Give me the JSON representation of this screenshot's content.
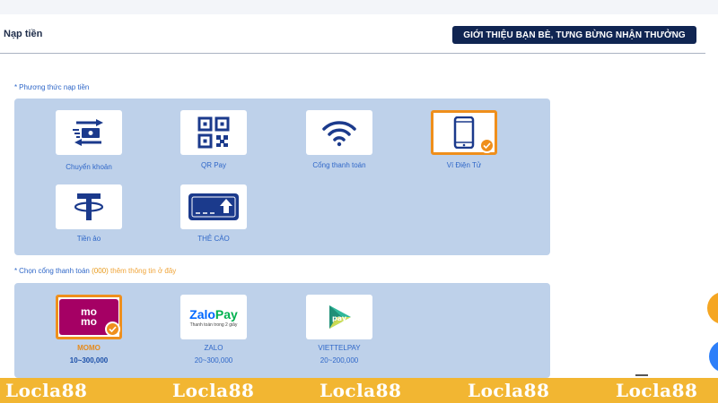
{
  "header": {
    "title": "Nạp tiền",
    "promo_button": "GIỚI THIỆU BẠN BÈ, TƯNG BỪNG NHẬN THƯỞNG"
  },
  "methods_section": {
    "required_mark": "*",
    "label": "Phương thức nạp tiền",
    "items": [
      {
        "label": "Chuyển khoản",
        "icon": "bank-transfer-icon",
        "selected": false
      },
      {
        "label": "QR Pay",
        "icon": "qr-code-icon",
        "selected": false
      },
      {
        "label": "Cổng thanh toán",
        "icon": "wifi-icon",
        "selected": false
      },
      {
        "label": "Ví Điện Tử",
        "icon": "smartphone-icon",
        "selected": true
      },
      {
        "label": "Tiền ảo",
        "icon": "tether-icon",
        "selected": false
      },
      {
        "label": "THẺ CÀO",
        "icon": "card-upload-icon",
        "selected": false
      }
    ]
  },
  "gateway_section": {
    "required_mark": "*",
    "label_prefix": "Chọn cổng thanh toán",
    "label_unit": "(000)",
    "label_suffix": "thêm thông tin ở đây",
    "items": [
      {
        "name": "MOMO",
        "range": "10~300,000",
        "logo": "momo-logo",
        "logo_text_top": "mo",
        "logo_text_bottom": "mo",
        "selected": true
      },
      {
        "name": "ZALO",
        "range": "20~300,000",
        "logo": "zalopay-logo",
        "logo_word_a": "Zalo",
        "logo_word_b": "Pay",
        "logo_tagline": "Thanh toán trong 2 giây",
        "selected": false
      },
      {
        "name": "VIETTELPAY",
        "range": "20~200,000",
        "logo": "viettelpay-logo",
        "logo_word": "pay",
        "selected": false
      }
    ]
  },
  "watermark": {
    "text": "Locla88",
    "color": "#ffffff",
    "bar_color": "#f2b632"
  },
  "colors": {
    "navy": "#102552",
    "panel": "#bed1ea",
    "link_blue": "#2f67c8",
    "selected_orange": "#ef8f1c"
  }
}
